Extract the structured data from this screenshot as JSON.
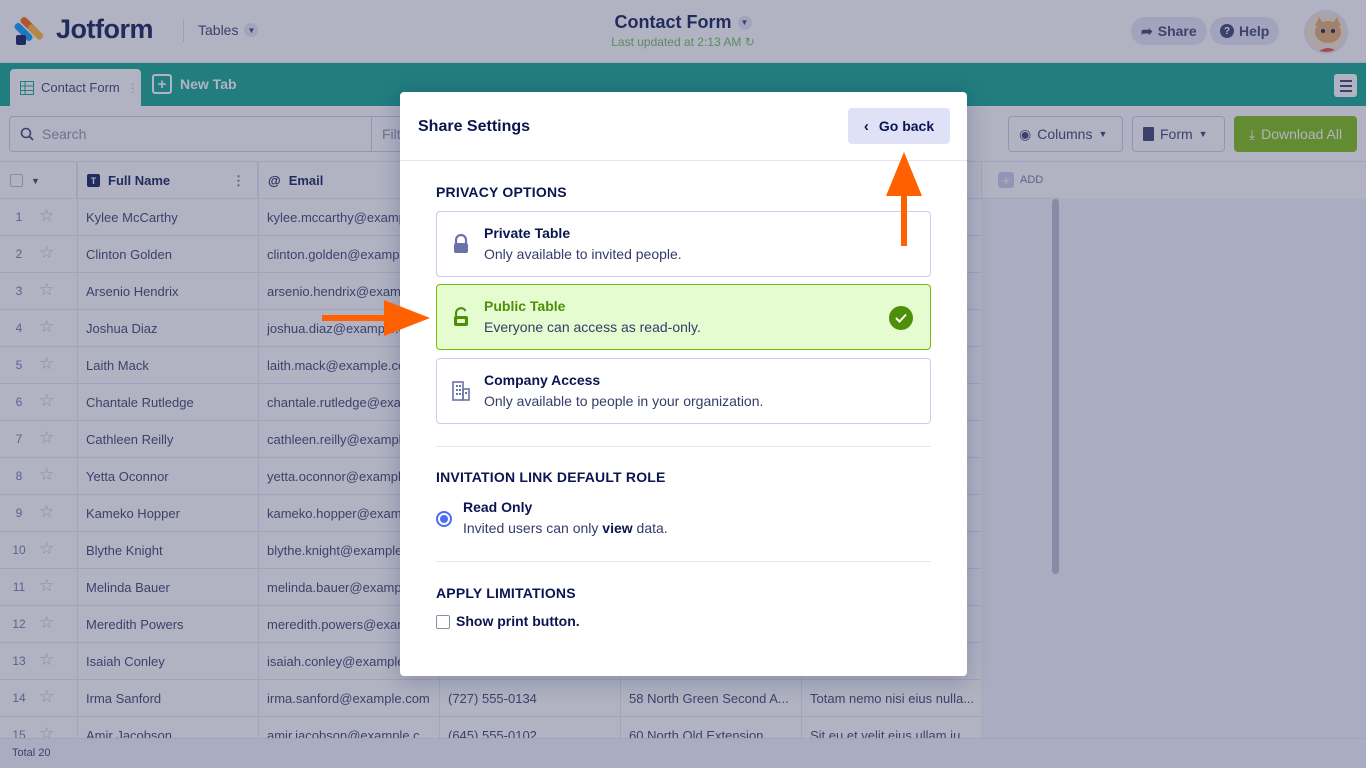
{
  "header": {
    "brand": "Jotform",
    "tables_label": "Tables",
    "form_title": "Contact Form",
    "last_updated": "Last updated at 2:13 AM",
    "share_label": "Share",
    "help_label": "Help"
  },
  "tabs": {
    "active_label": "Contact Form",
    "new_tab_label": "New Tab"
  },
  "toolbar": {
    "search_placeholder": "Search",
    "filter_label": "Filt",
    "columns_label": "Columns",
    "form_label": "Form",
    "download_label": "Download All"
  },
  "grid": {
    "columns": [
      "Full Name",
      "Email"
    ],
    "add_label": "ADD",
    "rows": [
      {
        "num": "1",
        "name": "Kylee McCarthy",
        "email": "kylee.mccarthy@example.com",
        "phone": "",
        "address": "",
        "message": ""
      },
      {
        "num": "2",
        "name": "Clinton Golden",
        "email": "clinton.golden@example.com",
        "phone": "",
        "address": "",
        "message": ""
      },
      {
        "num": "3",
        "name": "Arsenio Hendrix",
        "email": "arsenio.hendrix@example.com",
        "phone": "",
        "address": "",
        "message": ""
      },
      {
        "num": "4",
        "name": "Joshua Diaz",
        "email": "joshua.diaz@example.com",
        "phone": "",
        "address": "",
        "message": ""
      },
      {
        "num": "5",
        "name": "Laith Mack",
        "email": "laith.mack@example.com",
        "phone": "",
        "address": "",
        "message": ""
      },
      {
        "num": "6",
        "name": "Chantale Rutledge",
        "email": "chantale.rutledge@example.com",
        "phone": "",
        "address": "",
        "message": ""
      },
      {
        "num": "7",
        "name": "Cathleen Reilly",
        "email": "cathleen.reilly@example.com",
        "phone": "",
        "address": "",
        "message": ""
      },
      {
        "num": "8",
        "name": "Yetta Oconnor",
        "email": "yetta.oconnor@example.com",
        "phone": "",
        "address": "",
        "message": ""
      },
      {
        "num": "9",
        "name": "Kameko Hopper",
        "email": "kameko.hopper@example.com",
        "phone": "",
        "address": "",
        "message": ""
      },
      {
        "num": "10",
        "name": "Blythe Knight",
        "email": "blythe.knight@example.com",
        "phone": "",
        "address": "",
        "message": ""
      },
      {
        "num": "11",
        "name": "Melinda Bauer",
        "email": "melinda.bauer@example.com",
        "phone": "",
        "address": "",
        "message": ""
      },
      {
        "num": "12",
        "name": "Meredith Powers",
        "email": "meredith.powers@example.com",
        "phone": "",
        "address": "",
        "message": ""
      },
      {
        "num": "13",
        "name": "Isaiah Conley",
        "email": "isaiah.conley@example.com",
        "phone": "",
        "address": "",
        "message": ""
      },
      {
        "num": "14",
        "name": "Irma Sanford",
        "email": "irma.sanford@example.com",
        "phone": "(727) 555-0134",
        "address": "58 North Green Second A...",
        "message": "Totam nemo nisi eius nulla..."
      },
      {
        "num": "15",
        "name": "Amir Jacobson",
        "email": "amir.jacobson@example.c...",
        "phone": "(645) 555-0102",
        "address": "60 North Old Extension",
        "message": "Sit eu et velit eius ullam iu..."
      }
    ]
  },
  "footer": {
    "total": "Total 20"
  },
  "modal": {
    "title": "Share Settings",
    "go_back": "Go back",
    "privacy_title": "PRIVACY OPTIONS",
    "options": [
      {
        "name": "Private Table",
        "desc": "Only available to invited people.",
        "icon": "lock-icon",
        "selected": false
      },
      {
        "name": "Public Table",
        "desc": "Everyone can access as read-only.",
        "icon": "unlock-icon",
        "selected": true
      },
      {
        "name": "Company Access",
        "desc": "Only available to people in your organization.",
        "icon": "building-icon",
        "selected": false
      }
    ],
    "role_title": "INVITATION LINK DEFAULT ROLE",
    "role_name": "Read Only",
    "role_desc_pre": "Invited users can only ",
    "role_desc_bold": "view",
    "role_desc_post": " data.",
    "limits_title": "APPLY LIMITATIONS",
    "print_label": "Show print button."
  },
  "colors": {
    "accent_green": "#78bb07",
    "tab_teal": "#09a28a",
    "arrow_orange": "#ff6100",
    "selected_bg": "#e5fbd0"
  }
}
